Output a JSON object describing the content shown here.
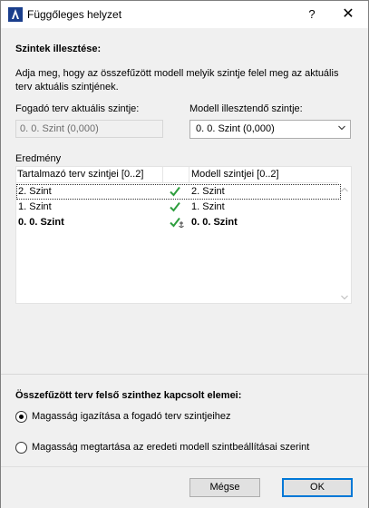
{
  "window": {
    "title": "Függőleges helyzet",
    "help_glyph": "?",
    "close_glyph": "✕"
  },
  "section_align": {
    "heading": "Szintek illesztése:",
    "description_line1": "Adja meg, hogy az összefűzött modell melyik szintje felel meg az aktuális",
    "description_line2": "terv aktuális szintjének.",
    "host_label": "Fogadó terv aktuális szintje:",
    "host_value": "0. 0. Szint (0,000)",
    "model_label": "Modell illesztendő szintje:",
    "model_selected": "0. 0. Szint (0,000)"
  },
  "result": {
    "label": "Eredmény",
    "col_host": "Tartalmazó terv szintjei [0..2]",
    "col_model": "Modell szintjei [0..2]",
    "rows": [
      {
        "host": "2. Szint",
        "model": "2. Szint",
        "bold": false,
        "selected": true,
        "check": "check-icon"
      },
      {
        "host": "1. Szint",
        "model": "1. Szint",
        "bold": false,
        "selected": false,
        "check": "check-icon"
      },
      {
        "host": "0. 0. Szint",
        "model": "0. 0. Szint",
        "bold": true,
        "selected": false,
        "check": "check-anchor-icon"
      }
    ]
  },
  "section_upper": {
    "heading": "Összefűzött terv felső szinthez kapcsolt elemei:",
    "option1": "Magasság igazítása a fogadó terv szintjeihez",
    "option2": "Magasság megtartása az eredeti modell szintbeállításai szerint",
    "selected_option": 1
  },
  "buttons": {
    "cancel": "Mégse",
    "ok": "OK"
  },
  "colors": {
    "check_green": "#2e9e3e",
    "accent_blue": "#0078d7"
  }
}
